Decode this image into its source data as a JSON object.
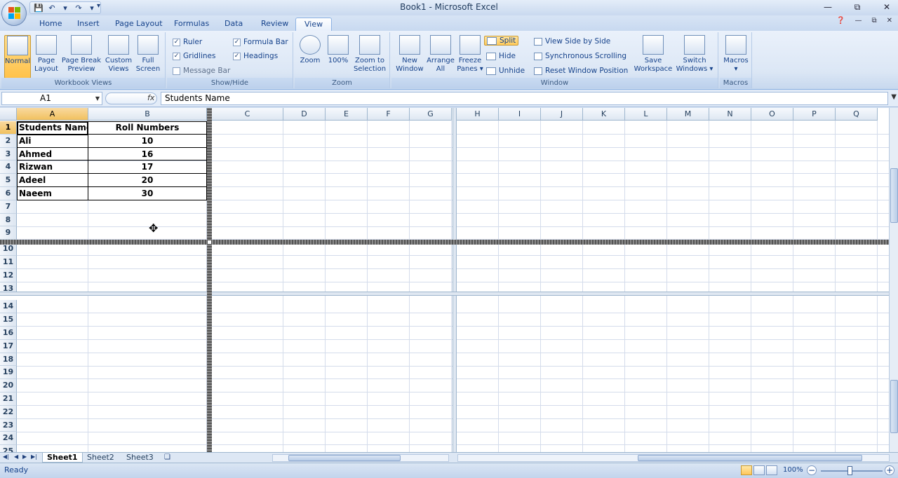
{
  "window": {
    "title": "Book1 - Microsoft Excel"
  },
  "quick_access": {
    "save_icon": "save-icon",
    "undo_icon": "undo-icon",
    "redo_icon": "redo-icon"
  },
  "tabs": [
    "Home",
    "Insert",
    "Page Layout",
    "Formulas",
    "Data",
    "Review",
    "View"
  ],
  "active_tab": "View",
  "ribbon": {
    "workbook_views": {
      "label": "Workbook Views",
      "normal": "Normal",
      "page_layout_1": "Page",
      "page_layout_2": "Layout",
      "page_break_1": "Page Break",
      "page_break_2": "Preview",
      "custom_1": "Custom",
      "custom_2": "Views",
      "full_1": "Full",
      "full_2": "Screen"
    },
    "show_hide": {
      "label": "Show/Hide",
      "ruler": "Ruler",
      "gridlines": "Gridlines",
      "message_bar": "Message Bar",
      "formula_bar": "Formula Bar",
      "headings": "Headings"
    },
    "zoom": {
      "label": "Zoom",
      "zoom": "Zoom",
      "hundred": "100%",
      "zoom_sel_1": "Zoom to",
      "zoom_sel_2": "Selection"
    },
    "window": {
      "label": "Window",
      "new_1": "New",
      "new_2": "Window",
      "arrange_1": "Arrange",
      "arrange_2": "All",
      "freeze_1": "Freeze",
      "freeze_2": "Panes",
      "split": "Split",
      "hide": "Hide",
      "unhide": "Unhide",
      "side_by_side": "View Side by Side",
      "sync_scroll": "Synchronous Scrolling",
      "reset_pos": "Reset Window Position",
      "save_ws_1": "Save",
      "save_ws_2": "Workspace",
      "switch_1": "Switch",
      "switch_2": "Windows"
    },
    "macros": {
      "label": "Macros",
      "macros": "Macros"
    }
  },
  "formula_bar": {
    "name_box": "A1",
    "fx": "fx",
    "content": "Students Name"
  },
  "columns": [
    "A",
    "B",
    "C",
    "D",
    "E",
    "F",
    "G",
    "H",
    "I",
    "J",
    "K",
    "L",
    "M",
    "N",
    "O",
    "P",
    "Q"
  ],
  "rows": [
    "1",
    "2",
    "3",
    "4",
    "5",
    "6",
    "7",
    "8",
    "9",
    "10",
    "11",
    "12",
    "13",
    "14",
    "15",
    "16",
    "17",
    "18",
    "19",
    "20",
    "21",
    "22",
    "23",
    "24",
    "25"
  ],
  "table": {
    "headers": [
      "Students Name",
      "Roll Numbers"
    ],
    "rows": [
      [
        "Ali",
        "10"
      ],
      [
        "Ahmed",
        "16"
      ],
      [
        "Rizwan",
        "17"
      ],
      [
        "Adeel",
        "20"
      ],
      [
        "Naeem",
        "30"
      ]
    ]
  },
  "sheets": [
    "Sheet1",
    "Sheet2",
    "Sheet3"
  ],
  "active_sheet": "Sheet1",
  "status": {
    "text": "Ready",
    "zoom": "100%"
  }
}
